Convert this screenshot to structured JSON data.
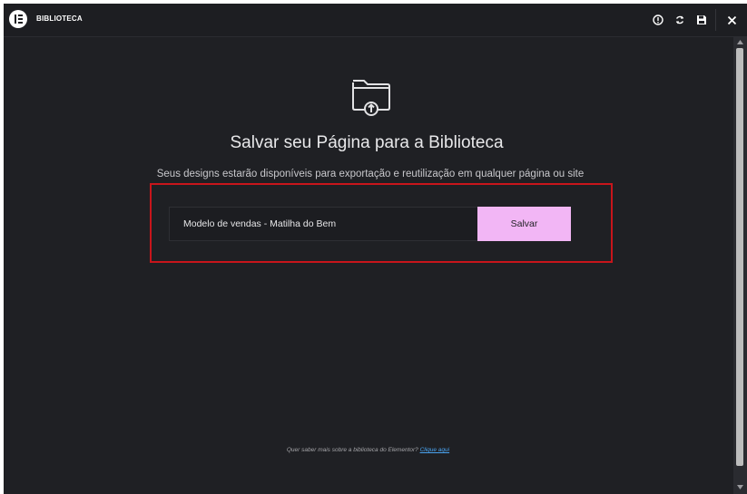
{
  "header": {
    "title": "BIBLIOTECA",
    "icons": [
      "help-icon",
      "sync-icon",
      "save-icon",
      "close-icon"
    ]
  },
  "main": {
    "icon": "folder-upload-icon",
    "headline": "Salvar seu Página para a Biblioteca",
    "subline": "Seus designs estarão disponíveis para exportação e reutilização em qualquer página ou site",
    "template_name_value": "Modelo de vendas - Matilha do Bem",
    "save_label": "Salvar"
  },
  "footer": {
    "text": "Quer saber mais sobre a biblioteca do Elementor? ",
    "link_label": "Clique aqui"
  },
  "colors": {
    "background": "#1f2024",
    "accent_button": "#f2b6f5",
    "highlight_border": "#c8151b",
    "link": "#4aa3f0"
  }
}
